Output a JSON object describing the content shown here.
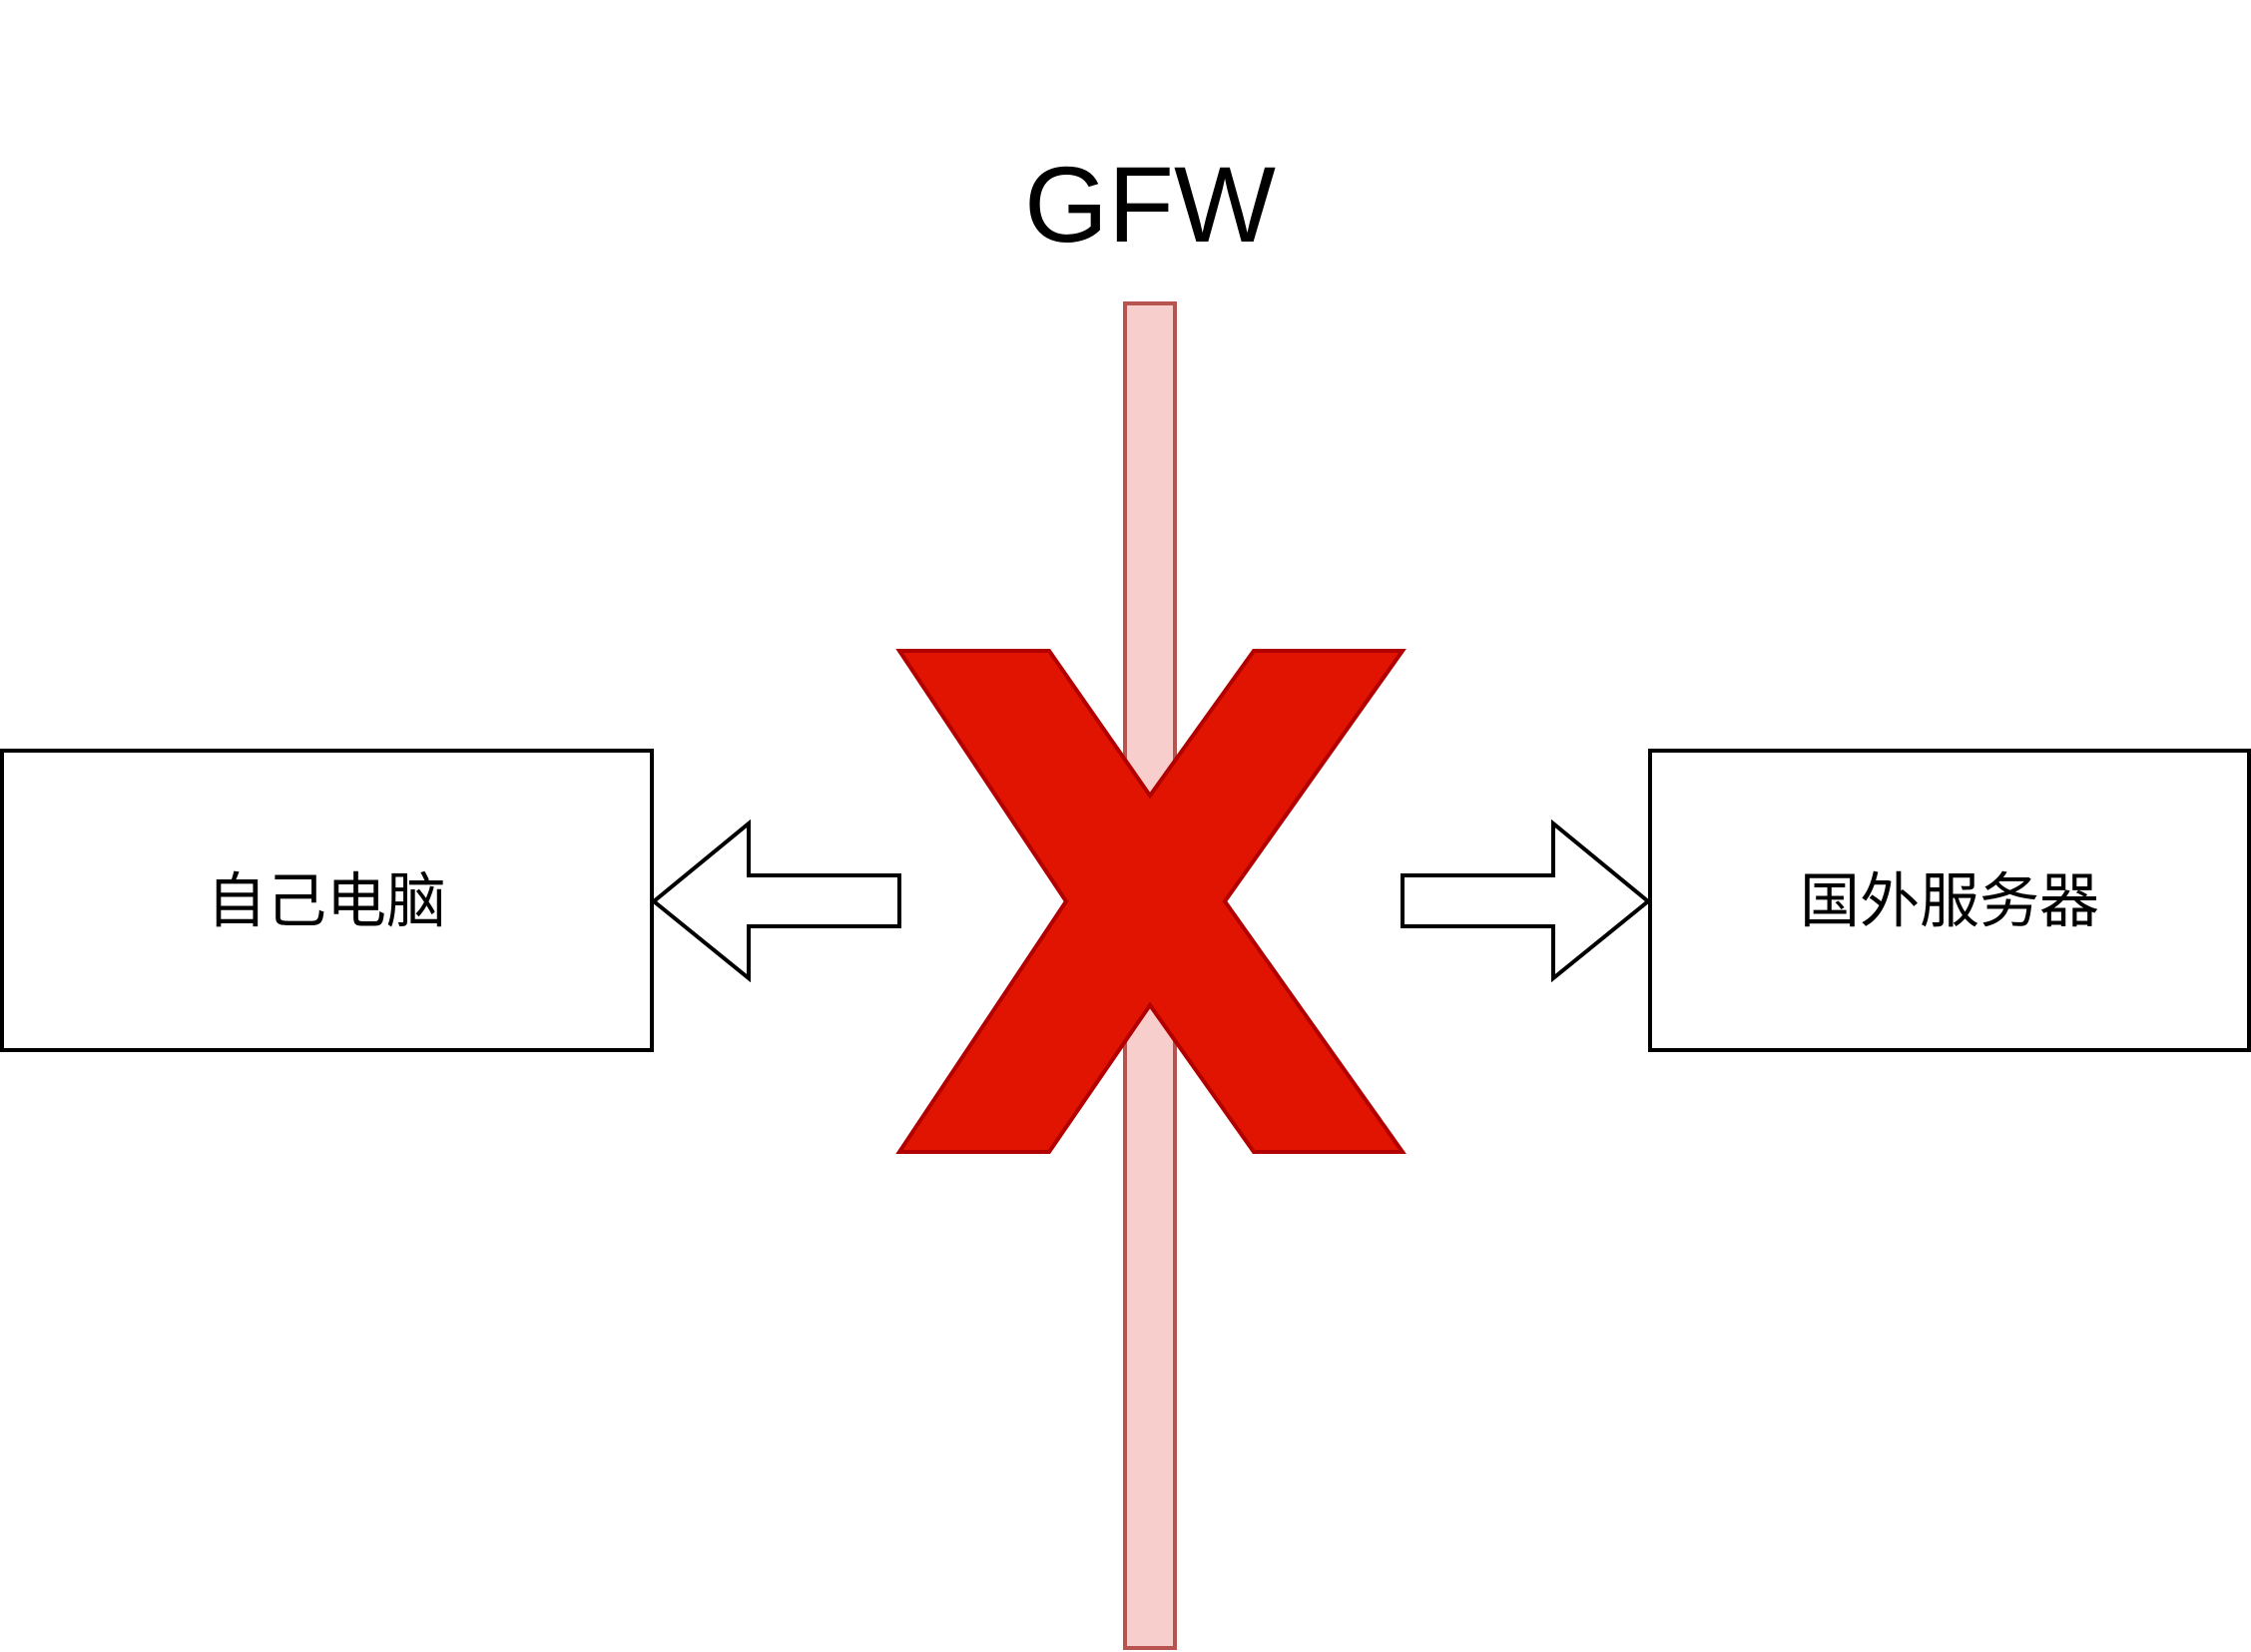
{
  "title": "GFW",
  "left_box": {
    "label": "自己电脑"
  },
  "right_box": {
    "label": "国外服务器"
  },
  "colors": {
    "wall_fill": "#f8cecc",
    "wall_stroke": "#b85450",
    "x_fill": "#e01400",
    "x_stroke": "#b20000",
    "box_stroke": "#000000",
    "background": "#ffffff"
  },
  "icons": {
    "block_mark": "x-icon",
    "left_arrow": "arrow-left-icon",
    "right_arrow": "arrow-right-icon"
  }
}
